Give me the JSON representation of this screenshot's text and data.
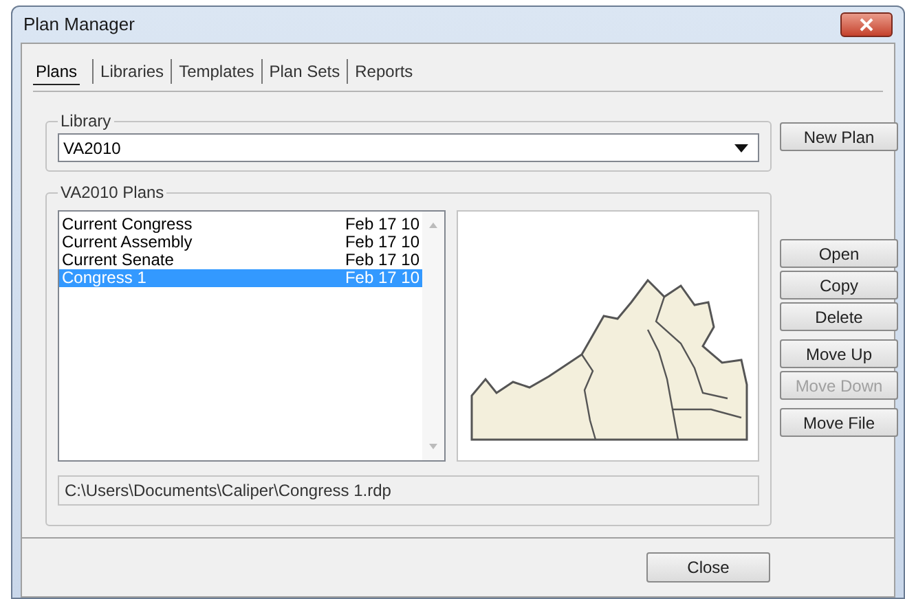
{
  "window": {
    "title": "Plan Manager"
  },
  "tabs": [
    {
      "label": "Plans",
      "selected": true
    },
    {
      "label": "Libraries",
      "selected": false
    },
    {
      "label": "Templates",
      "selected": false
    },
    {
      "label": "Plan Sets",
      "selected": false
    },
    {
      "label": "Reports",
      "selected": false
    }
  ],
  "library": {
    "label": "Library",
    "value": "VA2010"
  },
  "plans": {
    "label": "VA2010 Plans",
    "rows": [
      {
        "name": "Current Congress",
        "date": "Feb 17 10",
        "selected": false
      },
      {
        "name": "Current Assembly",
        "date": "Feb 17 10",
        "selected": false
      },
      {
        "name": "Current Senate",
        "date": "Feb 17 10",
        "selected": false
      },
      {
        "name": "Congress 1",
        "date": "Feb 17 10",
        "selected": true
      }
    ],
    "path": "C:\\Users\\Documents\\Caliper\\Congress 1.rdp"
  },
  "button_groups": [
    [
      {
        "label": "New Plan",
        "disabled": false
      }
    ],
    [
      {
        "label": "Open",
        "disabled": false
      },
      {
        "label": "Copy",
        "disabled": false
      },
      {
        "label": "Delete",
        "disabled": false
      }
    ],
    [
      {
        "label": "Move Up",
        "disabled": false
      },
      {
        "label": "Move Down",
        "disabled": true
      }
    ],
    [
      {
        "label": "Move File",
        "disabled": false
      }
    ]
  ],
  "close_button": "Close"
}
